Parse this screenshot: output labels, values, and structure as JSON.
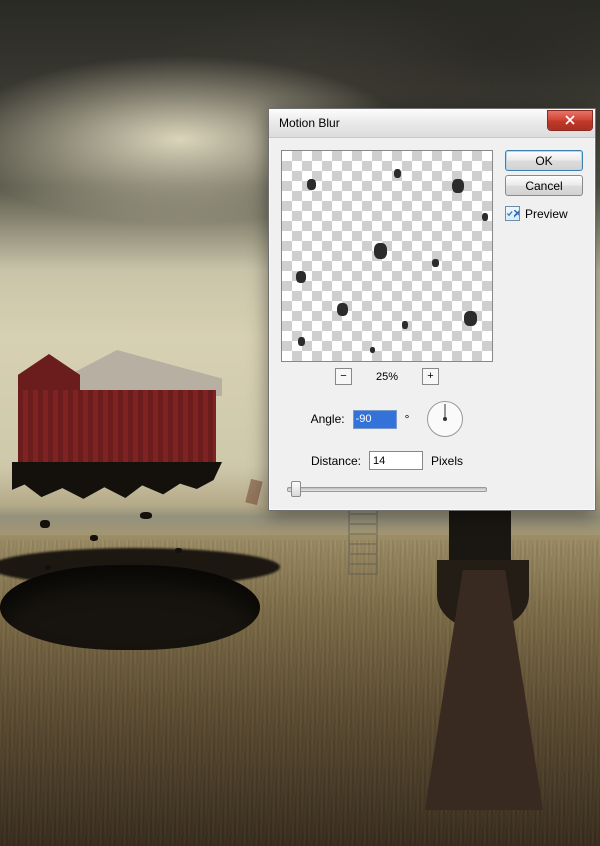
{
  "dialog": {
    "title": "Motion Blur",
    "ok_label": "OK",
    "cancel_label": "Cancel",
    "preview_label": "Preview",
    "preview_checked": true,
    "zoom_pct": "25%",
    "angle_label": "Angle:",
    "angle_value": "-90",
    "angle_degree_symbol": "°",
    "distance_label": "Distance:",
    "distance_value": "14",
    "distance_unit": "Pixels"
  }
}
